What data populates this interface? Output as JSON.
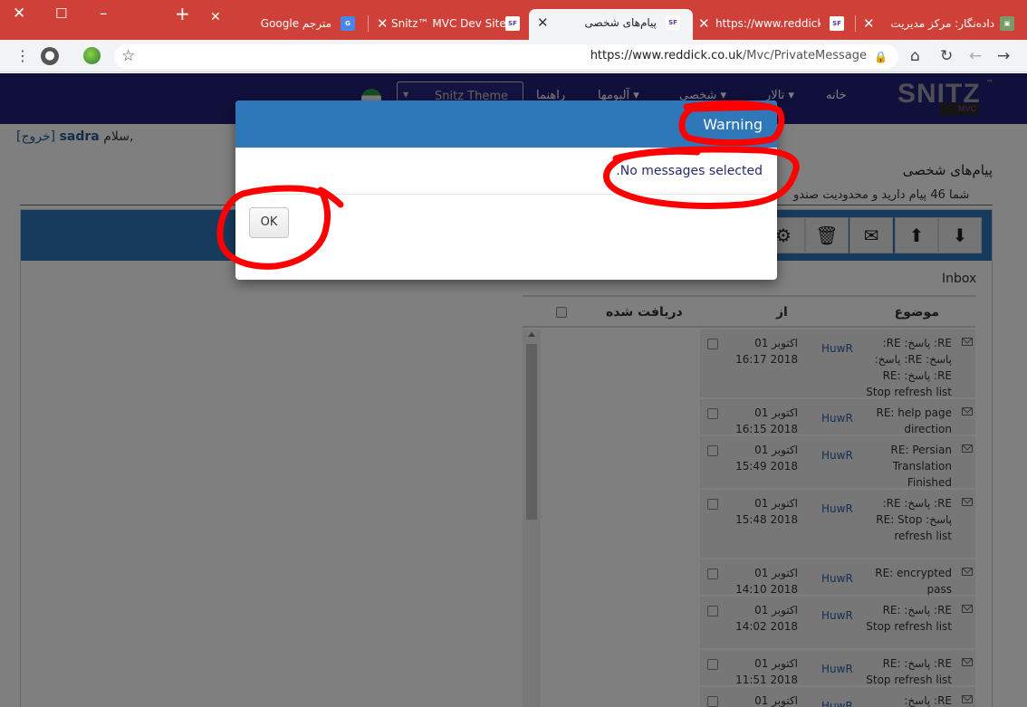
{
  "browser": {
    "tabs": [
      {
        "title": "داده‌نگار: مرکز مدیریت",
        "icon": "datanegar-favicon"
      },
      {
        "title": "https://www.reddick.c",
        "icon": "snitz-favicon"
      },
      {
        "title": "پیام‌های شخصی",
        "icon": "snitz-favicon"
      },
      {
        "title": "Snitz™ MVC Dev Site",
        "icon": "snitz-favicon"
      },
      {
        "title": "مترجم Google",
        "icon": "google-translate-favicon"
      }
    ],
    "new_tab": "+",
    "url_host": "https://www.reddick.co.uk",
    "url_path": "/Mvc/PrivateMessage"
  },
  "site": {
    "logo_text": "SNITZ",
    "logo_sub": "MVC",
    "logo_tm": "™",
    "nav": {
      "home": "خانه",
      "forums": "تالار",
      "personal": "شخصی",
      "albums": "آلبومها",
      "help": "راهنما"
    },
    "theme_select": "Snitz Theme",
    "greeting": {
      "hello": "سلام,",
      "user": "sadra",
      "logout": "[خروج]"
    }
  },
  "pm": {
    "title": "پیام‌های شخصی",
    "info": "شما 46 پیام دارید و محدودیت صندو",
    "folder": "Inbox",
    "columns": {
      "subject": "موضوع",
      "from": "از",
      "received": "دریافت شده"
    },
    "messages": [
      {
        "subject": "RE: پاسخ: RE: پاسخ: RE: پاسخ: RE: پاسخ: RE: Stop refresh list",
        "from": "HuwR",
        "date": "01 اکتوبر",
        "time": "16:17 2018"
      },
      {
        "subject": "RE: help page direction",
        "from": "HuwR",
        "date": "01 اکتوبر",
        "time": "16:15 2018"
      },
      {
        "subject": "RE: Persian Translation Finished",
        "from": "HuwR",
        "date": "01 اکتوبر",
        "time": "15:49 2018"
      },
      {
        "subject": "RE: پاسخ: RE: پاسخ: RE: Stop refresh list",
        "from": "HuwR",
        "date": "01 اکتوبر",
        "time": "15:48 2018"
      },
      {
        "subject": "RE: encrypted pass",
        "from": "HuwR",
        "date": "01 اکتوبر",
        "time": "14:10 2018"
      },
      {
        "subject": "RE: پاسخ: RE: Stop refresh list",
        "from": "HuwR",
        "date": "01 اکتوبر",
        "time": "14:02 2018"
      },
      {
        "subject": "RE: پاسخ: RE: Stop refresh list",
        "from": "HuwR",
        "date": "01 اکتوبر",
        "time": "11:51 2018"
      },
      {
        "subject": "RE: پاسخ:",
        "from": "HuwR",
        "date": "01 اکتوبر",
        "time": ""
      }
    ]
  },
  "dialog": {
    "title": "Warning",
    "message": "No messages selected.",
    "ok_label": "OK"
  },
  "colors": {
    "tabbar": "#cf4138",
    "navbar": "#23207a",
    "primary": "#2e77b8",
    "annotation": "#ff0000"
  }
}
